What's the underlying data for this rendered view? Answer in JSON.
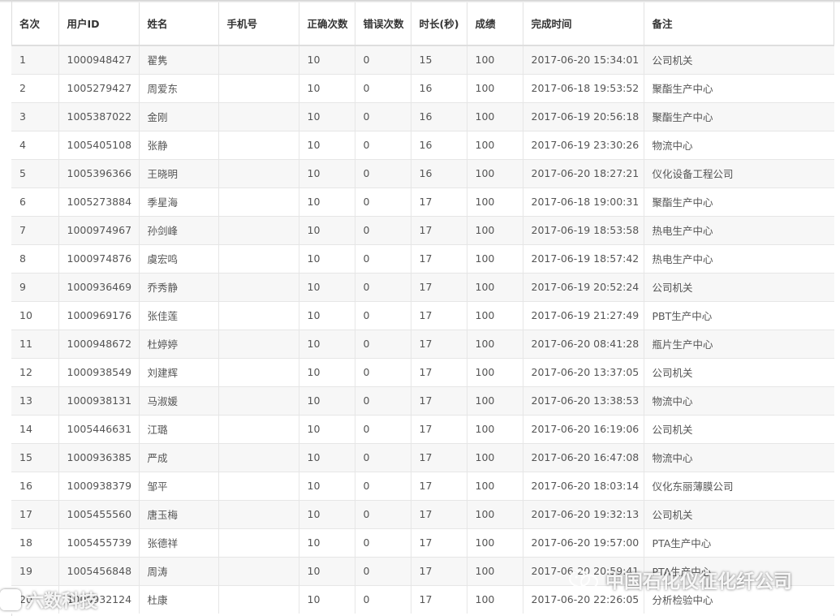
{
  "table": {
    "headers": {
      "rank": "名次",
      "user_id": "用户ID",
      "name": "姓名",
      "phone": "手机号",
      "correct": "正确次数",
      "wrong": "错误次数",
      "duration": "时长(秒)",
      "score": "成绩",
      "finish_time": "完成时间",
      "note": "备注"
    },
    "rows": [
      {
        "rank": "1",
        "user_id": "1000948427",
        "name": "翟隽",
        "phone": "",
        "correct": "10",
        "wrong": "0",
        "duration": "15",
        "score": "100",
        "finish_time": "2017-06-20 15:34:01",
        "note": "公司机关"
      },
      {
        "rank": "2",
        "user_id": "1005279427",
        "name": "周爱东",
        "phone": "",
        "correct": "10",
        "wrong": "0",
        "duration": "16",
        "score": "100",
        "finish_time": "2017-06-18 19:53:52",
        "note": "聚酯生产中心"
      },
      {
        "rank": "3",
        "user_id": "1005387022",
        "name": "金刚",
        "phone": "",
        "correct": "10",
        "wrong": "0",
        "duration": "16",
        "score": "100",
        "finish_time": "2017-06-19 20:56:18",
        "note": "聚酯生产中心"
      },
      {
        "rank": "4",
        "user_id": "1005405108",
        "name": "张静",
        "phone": "",
        "correct": "10",
        "wrong": "0",
        "duration": "16",
        "score": "100",
        "finish_time": "2017-06-19 23:30:26",
        "note": "物流中心"
      },
      {
        "rank": "5",
        "user_id": "1005396366",
        "name": "王晓明",
        "phone": "",
        "correct": "10",
        "wrong": "0",
        "duration": "16",
        "score": "100",
        "finish_time": "2017-06-20 18:27:21",
        "note": "仪化设备工程公司"
      },
      {
        "rank": "6",
        "user_id": "1005273884",
        "name": "季星海",
        "phone": "",
        "correct": "10",
        "wrong": "0",
        "duration": "17",
        "score": "100",
        "finish_time": "2017-06-18 19:00:31",
        "note": "聚酯生产中心"
      },
      {
        "rank": "7",
        "user_id": "1000974967",
        "name": "孙剑峰",
        "phone": "",
        "correct": "10",
        "wrong": "0",
        "duration": "17",
        "score": "100",
        "finish_time": "2017-06-19 18:53:58",
        "note": "热电生产中心"
      },
      {
        "rank": "8",
        "user_id": "1000974876",
        "name": "虞宏鸣",
        "phone": "",
        "correct": "10",
        "wrong": "0",
        "duration": "17",
        "score": "100",
        "finish_time": "2017-06-19 18:57:42",
        "note": "热电生产中心"
      },
      {
        "rank": "9",
        "user_id": "1000936469",
        "name": "乔秀静",
        "phone": "",
        "correct": "10",
        "wrong": "0",
        "duration": "17",
        "score": "100",
        "finish_time": "2017-06-19 20:52:24",
        "note": "公司机关"
      },
      {
        "rank": "10",
        "user_id": "1000969176",
        "name": "张佳莲",
        "phone": "",
        "correct": "10",
        "wrong": "0",
        "duration": "17",
        "score": "100",
        "finish_time": "2017-06-19 21:27:49",
        "note": "PBT生产中心"
      },
      {
        "rank": "11",
        "user_id": "1000948672",
        "name": "杜婷婷",
        "phone": "",
        "correct": "10",
        "wrong": "0",
        "duration": "17",
        "score": "100",
        "finish_time": "2017-06-20 08:41:28",
        "note": "瓶片生产中心"
      },
      {
        "rank": "12",
        "user_id": "1000938549",
        "name": "刘建辉",
        "phone": "",
        "correct": "10",
        "wrong": "0",
        "duration": "17",
        "score": "100",
        "finish_time": "2017-06-20 13:37:05",
        "note": "公司机关"
      },
      {
        "rank": "13",
        "user_id": "1000938131",
        "name": "马淑媛",
        "phone": "",
        "correct": "10",
        "wrong": "0",
        "duration": "17",
        "score": "100",
        "finish_time": "2017-06-20 13:38:53",
        "note": "物流中心"
      },
      {
        "rank": "14",
        "user_id": "1005446631",
        "name": "江璐",
        "phone": "",
        "correct": "10",
        "wrong": "0",
        "duration": "17",
        "score": "100",
        "finish_time": "2017-06-20 16:19:06",
        "note": "公司机关"
      },
      {
        "rank": "15",
        "user_id": "1000936385",
        "name": "严成",
        "phone": "",
        "correct": "10",
        "wrong": "0",
        "duration": "17",
        "score": "100",
        "finish_time": "2017-06-20 16:47:08",
        "note": "物流中心"
      },
      {
        "rank": "16",
        "user_id": "1000938379",
        "name": "邹平",
        "phone": "",
        "correct": "10",
        "wrong": "0",
        "duration": "17",
        "score": "100",
        "finish_time": "2017-06-20 18:03:14",
        "note": "仪化东丽薄膜公司"
      },
      {
        "rank": "17",
        "user_id": "1005455560",
        "name": "唐玉梅",
        "phone": "",
        "correct": "10",
        "wrong": "0",
        "duration": "17",
        "score": "100",
        "finish_time": "2017-06-20 19:32:13",
        "note": "公司机关"
      },
      {
        "rank": "18",
        "user_id": "1005455739",
        "name": "张德祥",
        "phone": "",
        "correct": "10",
        "wrong": "0",
        "duration": "17",
        "score": "100",
        "finish_time": "2017-06-20 19:57:00",
        "note": "PTA生产中心"
      },
      {
        "rank": "19",
        "user_id": "1005456848",
        "name": "周涛",
        "phone": "",
        "correct": "10",
        "wrong": "0",
        "duration": "17",
        "score": "100",
        "finish_time": "2017-06-20 20:59:41",
        "note": "PTA生产中心"
      },
      {
        "rank": "20",
        "user_id": "1000932124",
        "name": "杜康",
        "phone": "",
        "correct": "10",
        "wrong": "0",
        "duration": "17",
        "score": "100",
        "finish_time": "2017-06-20 22:26:05",
        "note": "分析检验中心"
      }
    ]
  },
  "watermarks": {
    "left": "六数科技",
    "right": "中国石化仪征化纤公司"
  },
  "icons": {
    "left_logo": "sticker-logo-icon",
    "right_logo": "wechat-icon"
  },
  "colors": {
    "odd_row": "#f7f7f7",
    "even_row": "#ffffff",
    "grid": "#e6e6e6",
    "text": "#555555"
  }
}
